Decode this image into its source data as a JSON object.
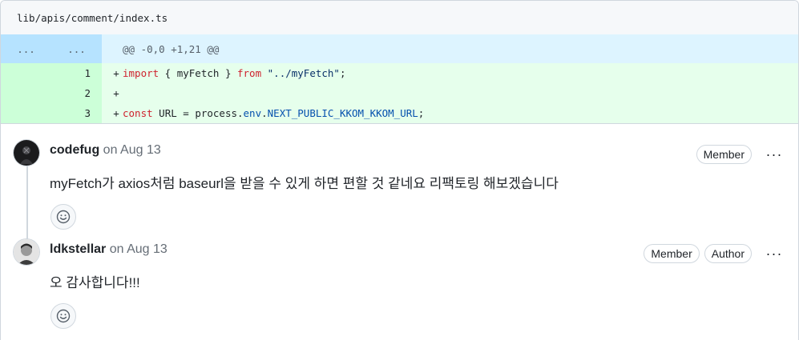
{
  "file": {
    "path": "lib/apis/comment/index.ts"
  },
  "diff": {
    "hunk": {
      "left_num": "...",
      "right_num": "...",
      "text": "@@ -0,0 +1,21 @@"
    },
    "lines": [
      {
        "num": "1",
        "sign": "+"
      },
      {
        "num": "2",
        "sign": "+"
      },
      {
        "num": "3",
        "sign": "+"
      }
    ],
    "line1": {
      "kw": "import",
      "mid": " { myFetch } ",
      "kw2": "from",
      "sp": " ",
      "str": "\"../myFetch\"",
      "end": ";"
    },
    "line3": {
      "kw": "const",
      "mid": " URL = process.",
      "prop1": "env",
      "dot": ".",
      "prop2": "NEXT_PUBLIC_KKOM_KKOM_URL",
      "end": ";"
    }
  },
  "comments": [
    {
      "author": "codefug",
      "date": "on Aug 13",
      "badges": [
        "Member"
      ],
      "body": "myFetch가 axios처럼 baseurl을 받을 수 있게 하면 편할 것 같네요 리팩토링 해보겠습니다",
      "more": "···"
    },
    {
      "author": "ldkstellar",
      "date": "on Aug 13",
      "badges": [
        "Member",
        "Author"
      ],
      "body": "오 감사합니다!!!",
      "more": "···"
    }
  ],
  "icons": {
    "reaction": "smiley-icon",
    "menu": "kebab-horizontal-icon"
  }
}
